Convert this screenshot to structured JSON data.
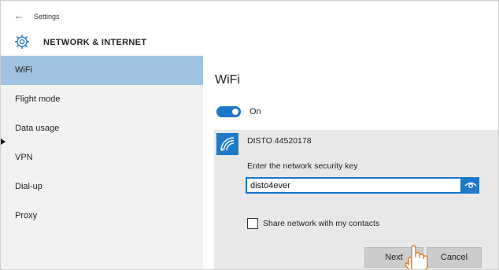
{
  "window": {
    "title": "Settings"
  },
  "header": {
    "title": "NETWORK & INTERNET"
  },
  "sidebar": {
    "items": [
      {
        "label": "WiFi",
        "selected": true
      },
      {
        "label": "Flight mode",
        "selected": false
      },
      {
        "label": "Data usage",
        "selected": false
      },
      {
        "label": "VPN",
        "selected": false
      },
      {
        "label": "Dial-up",
        "selected": false
      },
      {
        "label": "Proxy",
        "selected": false
      }
    ]
  },
  "main": {
    "title": "WiFi",
    "toggle": {
      "label": "On",
      "state": true
    },
    "network": {
      "ssid": "DISTO 44520178",
      "key_label": "Enter the network security key",
      "password_value": "disto4ever",
      "share_label": "Share network with my contacts",
      "share_checked": false,
      "next_label": "Next",
      "cancel_label": "Cancel"
    }
  },
  "colors": {
    "accent": "#1976c8",
    "selected_bg": "#9fc3e0",
    "sidebar_bg": "#f2f2f2",
    "panel_bg": "#e8e8e8"
  },
  "icons": [
    "back-arrow-icon",
    "gear-icon",
    "wifi-icon",
    "eye-icon",
    "hand-cursor-icon",
    "pointer-arrow-icon"
  ]
}
